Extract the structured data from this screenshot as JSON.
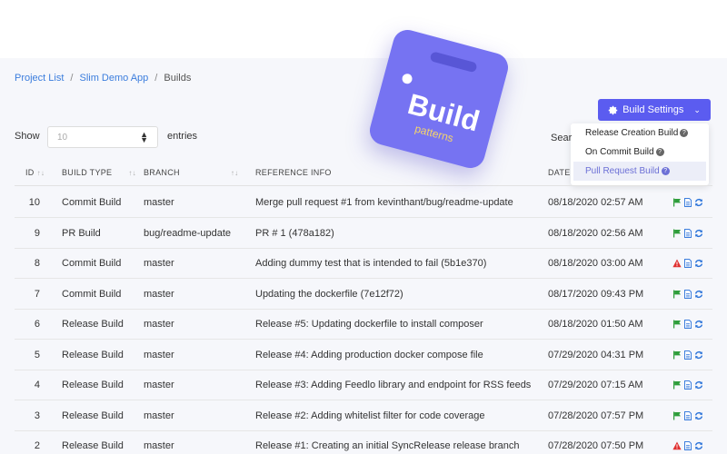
{
  "breadcrumb": {
    "project_list": "Project List",
    "sep1": "/",
    "app": "Slim Demo App",
    "sep2": "/",
    "current": "Builds"
  },
  "controls": {
    "show": "Show",
    "entries_value": "10",
    "entries": "entries",
    "search": "Sear"
  },
  "settings": {
    "button_label": "Build Settings",
    "menu": [
      "Release Creation Build",
      "On Commit Build",
      "Pull Request Build"
    ]
  },
  "logo": {
    "title": "Build",
    "subtitle": "patterns"
  },
  "table": {
    "headers": {
      "id": "ID",
      "type": "BUILD TYPE",
      "branch": "BRANCH",
      "ref": "REFERENCE INFO",
      "date": "DATE"
    },
    "rows": [
      {
        "id": "10",
        "type": "Commit Build",
        "branch": "master",
        "ref": "Merge pull request #1 from kevinthant/bug/readme-update",
        "date": "08/18/2020 02:57 AM",
        "status": "flag"
      },
      {
        "id": "9",
        "type": "PR Build",
        "branch": "bug/readme-update",
        "ref": "PR # 1 (478a182)",
        "date": "08/18/2020 02:56 AM",
        "status": "flag"
      },
      {
        "id": "8",
        "type": "Commit Build",
        "branch": "master",
        "ref": "Adding dummy test that is intended to fail (5b1e370)",
        "date": "08/18/2020 03:00 AM",
        "status": "warning"
      },
      {
        "id": "7",
        "type": "Commit Build",
        "branch": "master",
        "ref": "Updating the dockerfile (7e12f72)",
        "date": "08/17/2020 09:43 PM",
        "status": "flag"
      },
      {
        "id": "6",
        "type": "Release Build",
        "branch": "master",
        "ref": "Release #5: Updating dockerfile to install composer",
        "date": "08/18/2020 01:50 AM",
        "status": "flag"
      },
      {
        "id": "5",
        "type": "Release Build",
        "branch": "master",
        "ref": "Release #4: Adding production docker compose file",
        "date": "07/29/2020 04:31 PM",
        "status": "flag"
      },
      {
        "id": "4",
        "type": "Release Build",
        "branch": "master",
        "ref": "Release #3: Adding Feedlo library and endpoint for RSS feeds",
        "date": "07/29/2020 07:15 AM",
        "status": "flag"
      },
      {
        "id": "3",
        "type": "Release Build",
        "branch": "master",
        "ref": "Release #2: Adding whitelist filter for code coverage",
        "date": "07/28/2020 07:57 PM",
        "status": "flag"
      },
      {
        "id": "2",
        "type": "Release Build",
        "branch": "master",
        "ref": "Release #1: Creating an initial SyncRelease release branch",
        "date": "07/28/2020 07:50 PM",
        "status": "warning"
      }
    ]
  },
  "colors": {
    "accent": "#5b5cf0",
    "link": "#3b7ddd",
    "flag": "#2e9d3a",
    "warning": "#e03131",
    "doc": "#3b7ddd",
    "refresh": "#2a73d9"
  },
  "icons": {
    "settings": "gear-icon",
    "flag": "flag-icon",
    "warning": "warning-icon",
    "doc": "document-icon",
    "refresh": "refresh-icon"
  }
}
